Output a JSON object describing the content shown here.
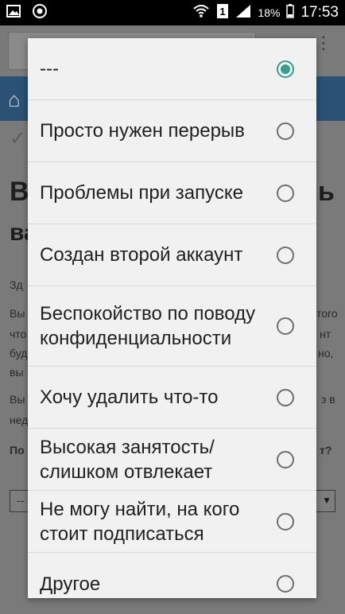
{
  "status_bar": {
    "time": "17:53",
    "battery": "18%",
    "icons": [
      "image-icon",
      "chrome-icon",
      "wifi-icon",
      "sim-1-icon",
      "signal-icon"
    ]
  },
  "background": {
    "title_fragment": "Вр",
    "title_fragment_right": "ь",
    "subtitle_fragment": "ва",
    "lines": [
      {
        "left": "Зд",
        "right": ""
      },
      {
        "left": "Вы",
        "right": "того"
      },
      {
        "left": "что",
        "right": "нт"
      },
      {
        "left": "буд",
        "right": "но,"
      },
      {
        "left": "вы",
        "right": ""
      },
      {
        "left": "Вы",
        "right": "з в"
      },
      {
        "left": "нед",
        "right": ""
      },
      {
        "left": "По",
        "right": "т?"
      }
    ],
    "select_value": "--"
  },
  "dialog": {
    "accent_color": "#3a9c8c",
    "options": [
      {
        "label": "---",
        "selected": true
      },
      {
        "label": "Просто нужен перерыв",
        "selected": false
      },
      {
        "label": "Проблемы при запуске",
        "selected": false
      },
      {
        "label": "Создан второй аккаунт",
        "selected": false
      },
      {
        "label": "Беспокойство по поводу конфиденциальности",
        "selected": false
      },
      {
        "label": "Хочу удалить что-то",
        "selected": false
      },
      {
        "label": "Высокая занятость/ слишком отвлекает",
        "selected": false
      },
      {
        "label": "Не могу найти, на кого стоит подписаться",
        "selected": false
      },
      {
        "label": "Другое",
        "selected": false
      }
    ]
  }
}
